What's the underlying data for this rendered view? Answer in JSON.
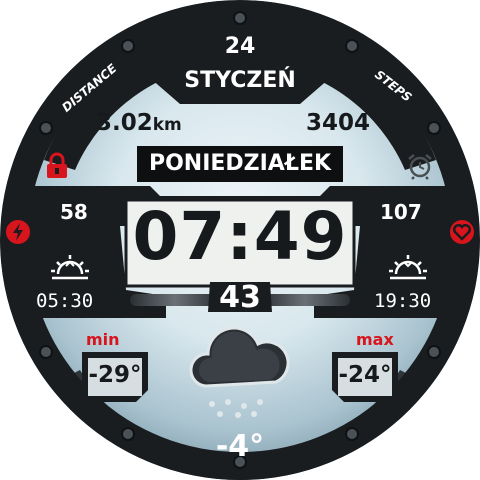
{
  "date": {
    "day": "24",
    "month": "STYCZEŃ",
    "weekday": "PONIEDZIAŁEK"
  },
  "arc_labels": {
    "left": "DISTANCE",
    "right": "STEPS"
  },
  "distance": {
    "value": "3.02",
    "unit": "km"
  },
  "steps": {
    "value": "3404"
  },
  "battery": {
    "value": "58",
    "icon": "lightning-icon"
  },
  "heart_rate": {
    "value": "107",
    "icon": "heart-icon"
  },
  "time": {
    "display": "07:49"
  },
  "seconds": {
    "value": "43"
  },
  "sun": {
    "sunrise": "05:30",
    "sunset": "19:30"
  },
  "temperature": {
    "min_label": "min",
    "min_value": "-29°",
    "max_label": "max",
    "max_value": "-24°",
    "current": "-4°"
  },
  "weather": {
    "condition_icon": "cloud-rain-icon"
  },
  "colors": {
    "accent_red": "#d8141c",
    "frame": "#1a1d20",
    "sky": "#d9e8ee"
  }
}
